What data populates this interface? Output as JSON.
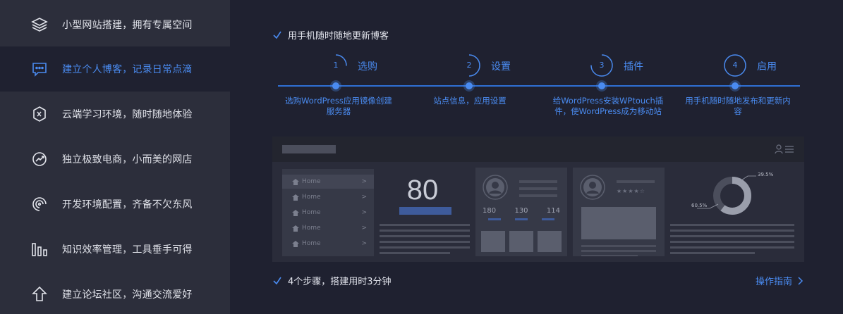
{
  "sidebar": {
    "items": [
      {
        "label": "小型网站搭建，拥有专属空间",
        "icon": "layers-icon"
      },
      {
        "label": "建立个人博客，记录日常点滴",
        "icon": "chat-bubble-icon",
        "active": true
      },
      {
        "label": "云端学习环境，随时随地体验",
        "icon": "hexagon-icon"
      },
      {
        "label": "独立极致电商，小而美的网店",
        "icon": "trend-circle-icon"
      },
      {
        "label": "开发环境配置，齐备不欠东风",
        "icon": "spiral-icon"
      },
      {
        "label": "知识效率管理，工具垂手可得",
        "icon": "bar-chart-icon"
      },
      {
        "label": "建立论坛社区，沟通交流爱好",
        "icon": "arrow-up-icon"
      }
    ]
  },
  "main": {
    "headline": "用手机随时随地更新博客",
    "steps": [
      {
        "num": "1",
        "title": "选购",
        "desc": "选购WordPress应用镜像创建服务器"
      },
      {
        "num": "2",
        "title": "设置",
        "desc": "站点信息，应用设置"
      },
      {
        "num": "3",
        "title": "插件",
        "desc": "给WordPress安装WPtouch插件，使WordPress成为移动站"
      },
      {
        "num": "4",
        "title": "启用",
        "desc": "用手机随时随地发布和更新内容"
      }
    ],
    "summary": "4个步骤，搭建用时3分钟",
    "guide_link": "操作指南"
  },
  "preview": {
    "nav_items": [
      "Home",
      "Home",
      "Home",
      "Home",
      "Home"
    ],
    "stat_number": "80",
    "profile_stats": [
      "180",
      "130",
      "114"
    ],
    "donut_percent": 60.5,
    "donut_labels": {
      "inner": "60.5%",
      "outer": "39.5%"
    }
  },
  "colors": {
    "accent": "#4a8bf0",
    "sidebar_bg": "#2c2e3b",
    "main_bg": "#1f2130"
  }
}
